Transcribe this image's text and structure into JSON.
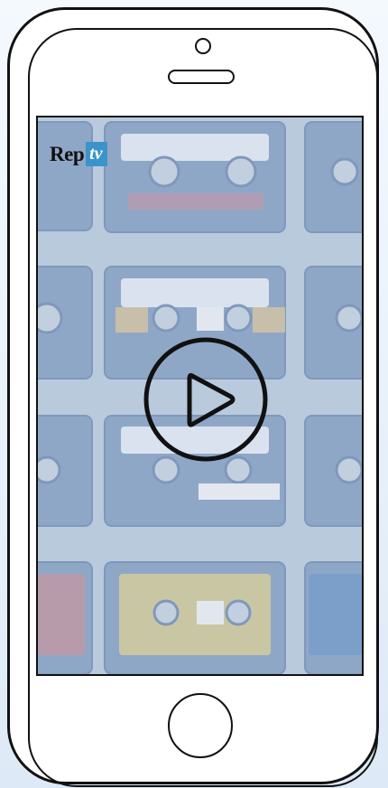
{
  "device": {
    "type": "smartphone-frame",
    "icons": [
      "camera-icon",
      "speaker-icon",
      "home-button-icon"
    ]
  },
  "video": {
    "logo": {
      "text_main": "Rep",
      "text_badge": "tv",
      "badge_color": "#3a94c9"
    },
    "play_icon": "play-icon",
    "colors": {
      "overlay": "#b6c8dd",
      "frame": "#111111"
    }
  }
}
